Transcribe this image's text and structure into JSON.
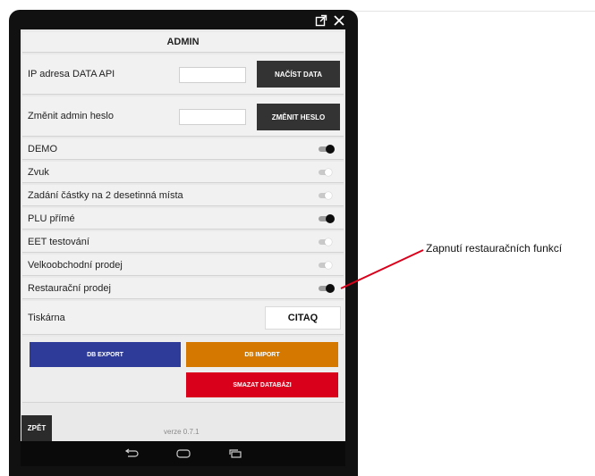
{
  "admin": {
    "title": "ADMIN"
  },
  "ip_row": {
    "label": "IP adresa DATA API",
    "input_value": "",
    "button_label": "NAČÍST DATA"
  },
  "password_row": {
    "label": "Změnit admin heslo",
    "input_value": "",
    "button_label": "ZMĚNIT HESLO"
  },
  "toggles": [
    {
      "label": "DEMO",
      "on": true
    },
    {
      "label": "Zvuk",
      "on": false
    },
    {
      "label": "Zadání částky na 2 desetinná místa",
      "on": false
    },
    {
      "label": "PLU přímé",
      "on": true
    },
    {
      "label": "EET testování",
      "on": false
    },
    {
      "label": "Velkoobchodní prodej",
      "on": false
    },
    {
      "label": "Restaurační prodej",
      "on": true
    }
  ],
  "printer_row": {
    "label": "Tiskárna",
    "value": "CITAQ"
  },
  "db_buttons": {
    "export_label": "DB EXPORT",
    "import_label": "DB IMPORT",
    "delete_label": "SMAZAT DATABÁZI",
    "export_color": "#2e3b99",
    "import_color": "#d47800",
    "delete_color": "#d9001b"
  },
  "footer": {
    "back_label": "ZPĚT",
    "version": "verze 0.7.1"
  },
  "annotation": {
    "text": "Zapnutí restauračních funkcí",
    "color": "#d9001b"
  },
  "icons": {
    "window": [
      "open-external-icon",
      "close-icon"
    ],
    "navbar": [
      "back-arrow-icon",
      "home-icon",
      "recent-apps-icon"
    ]
  }
}
